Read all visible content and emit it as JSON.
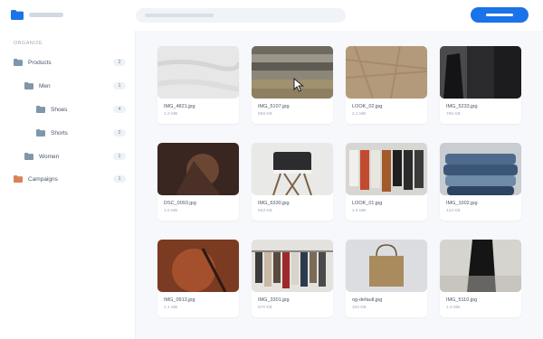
{
  "sidebar": {
    "section_label": "ORGANIZE",
    "items": [
      {
        "label": "Products",
        "count": "2"
      },
      {
        "label": "Men",
        "count": "1"
      },
      {
        "label": "Shoes",
        "count": "4"
      },
      {
        "label": "Shorts",
        "count": "2"
      },
      {
        "label": "Women",
        "count": "1"
      },
      {
        "label": "Campaigns",
        "count": "1"
      }
    ]
  },
  "colors": {
    "accent": "#1a73e8",
    "folder_blue": "#1a73e8",
    "folder_slate": "#7f97aa",
    "folder_orange": "#d9825a"
  },
  "files": [
    {
      "name": "IMG_4821.jpg",
      "size": "1.2 MB"
    },
    {
      "name": "IMG_5107.jpg",
      "size": "858 KB"
    },
    {
      "name": "LOOK_02.jpg",
      "size": "2.1 MB"
    },
    {
      "name": "IMG_5233.jpg",
      "size": "765 KB"
    },
    {
      "name": "DSC_0093.jpg",
      "size": "1.5 MB"
    },
    {
      "name": "IMG_6330.jpg",
      "size": "933 KB"
    },
    {
      "name": "LOOK_01.jpg",
      "size": "1.8 MB"
    },
    {
      "name": "IMG_1002.jpg",
      "size": "410 KB"
    },
    {
      "name": "IMG_0913.jpg",
      "size": "1.1 MB"
    },
    {
      "name": "IMG_3301.jpg",
      "size": "670 KB"
    },
    {
      "name": "og-default.jpg",
      "size": "320 KB"
    },
    {
      "name": "IMG_5110.jpg",
      "size": "1.4 MB"
    }
  ]
}
